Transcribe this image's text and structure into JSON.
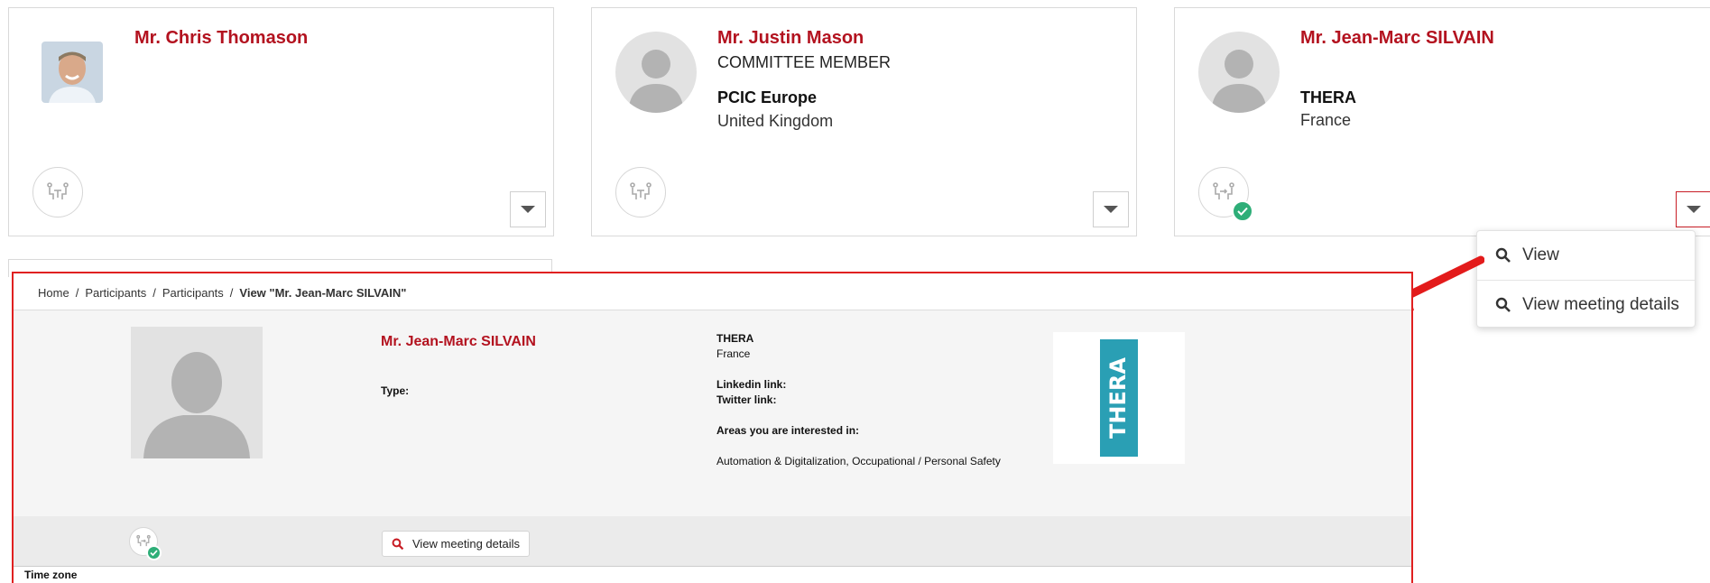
{
  "cards": [
    {
      "name": "Mr. Chris Thomason",
      "role": "",
      "organization": "",
      "country": ""
    },
    {
      "name": "Mr. Justin Mason",
      "role": "COMMITTEE MEMBER",
      "organization": "PCIC Europe",
      "country": "United Kingdom"
    },
    {
      "name": "Mr. Jean-Marc SILVAIN",
      "role": "",
      "organization": "THERA",
      "country": "France"
    }
  ],
  "menu": {
    "view_label": "View",
    "view_meeting_label": "View meeting details"
  },
  "breadcrumb": {
    "home": "Home",
    "participants1": "Participants",
    "participants2": "Participants",
    "current": "View \"Mr. Jean-Marc SILVAIN\""
  },
  "detail": {
    "name": "Mr. Jean-Marc SILVAIN",
    "type_label": "Type:",
    "organization": "THERA",
    "country": "France",
    "linkedin_label": "Linkedin link:",
    "twitter_label": "Twitter link:",
    "areas_label": "Areas you are interested in:",
    "areas_value": "Automation & Digitalization, Occupational / Personal Safety",
    "meeting_button_label": "View meeting details",
    "timezone_label": "Time zone",
    "logo_text": "THERA"
  },
  "colors": {
    "accent_red": "#b3121f",
    "highlight_red": "#e02020",
    "success_green": "#2eae78",
    "logo_teal": "#2a9fb4"
  },
  "icons": [
    "meeting-table-icon",
    "check-icon",
    "caret-down-icon",
    "search-icon",
    "arrow-icon",
    "avatar-placeholder-icon"
  ]
}
